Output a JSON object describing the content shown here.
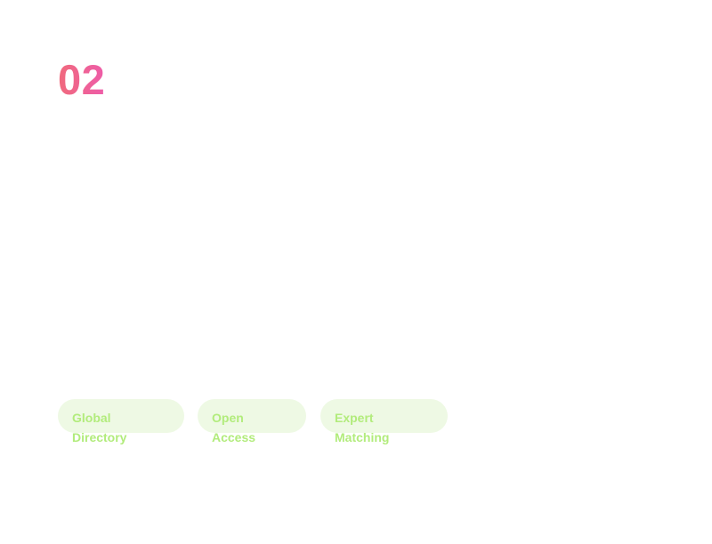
{
  "slide": {
    "number": "02"
  },
  "tags": [
    {
      "label": "Global Directory"
    },
    {
      "label": "Open Access"
    },
    {
      "label": "Expert Matching"
    }
  ],
  "colors": {
    "number_gradient_start": "#f06a7c",
    "number_gradient_end": "#ee5ca9",
    "tag_background": "#eef9e4",
    "tag_text": "#b2ec7c"
  }
}
